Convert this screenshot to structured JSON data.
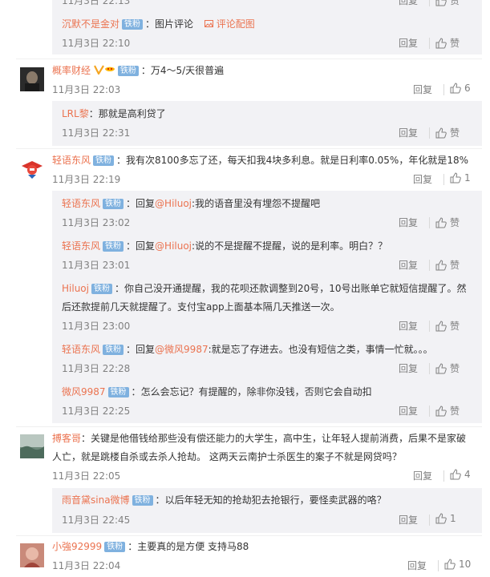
{
  "labels": {
    "reply": "回复",
    "like": "赞",
    "fan_badge": "铁粉"
  },
  "top_partial": {
    "reply": "回复",
    "like": "赞"
  },
  "r0": {
    "name": "沉默不是金对",
    "badge": "铁粉",
    "text": "图片评论",
    "pic_link": "评论配图",
    "time": "11月3日 22:10"
  },
  "c1": {
    "name": "概率财经",
    "badge": "铁粉",
    "text": "万4～5/天很普遍",
    "time": "11月3日 22:03",
    "likes": "6"
  },
  "r1": {
    "name": "LRL黎",
    "text": "那就是高利贷了",
    "time": "11月3日 22:31"
  },
  "c2": {
    "name": "轻语东风",
    "badge": "铁粉",
    "text": "我有次8100多忘了还，每天扣我4块多利息。就是日利率0.05%，年化就是18%",
    "time": "11月3日 22:19",
    "likes": "1"
  },
  "r2a": {
    "name": "轻语东风",
    "badge": "铁粉",
    "prefix": "回复",
    "mention": "@Hiluoj",
    "text": ":我的语音里没有埋怨不提醒吧",
    "time": "11月3日 23:02"
  },
  "r2b": {
    "name": "轻语东风",
    "badge": "铁粉",
    "prefix": "回复",
    "mention": "@Hiluoj",
    "text": ":说的不是提醒不提醒，说的是利率。明白？？",
    "time": "11月3日 23:01"
  },
  "r2c": {
    "name": "Hiluoj",
    "badge": "铁粉",
    "text_line1": "你自己没开通提醒，我的花呗还款调整到20号，10号出账单它就短信提醒了。然",
    "text_line2": "后还款提前几天就提醒了。支付宝app上面基本隔几天推送一次。",
    "time": "11月3日 23:00"
  },
  "r2d": {
    "name": "轻语东风",
    "badge": "铁粉",
    "prefix": "回复",
    "mention": "@微风9987",
    "text": ":就是忘了存进去。也没有短信之类，事情一忙就。。。",
    "time": "11月3日 22:28"
  },
  "r2e": {
    "name": "微风9987",
    "badge": "铁粉",
    "text": "怎么会忘记？有提醒的，除非你没钱，否则它会自动扣",
    "time": "11月3日 22:25"
  },
  "c3": {
    "name": "搏客哥",
    "text_line1": "关键是他借钱给那些没有偿还能力的大学生，高中生，让年轻人提前消费，后果不是家破",
    "text_line2": "人亡，就是跳楼自杀或去杀人抢劫。 这两天云南护士杀医生的案子不就是网贷吗？",
    "time": "11月3日 22:05",
    "likes": "4"
  },
  "r3": {
    "name": "雨音黛sina微博",
    "badge": "铁粉",
    "text": "以后年轻无知的抢劫犯去抢银行，要怪卖武器的咯？",
    "time": "11月3日 22:45",
    "likes": "1"
  },
  "c4": {
    "name": "小強92999",
    "badge": "铁粉",
    "text": "主要真的是方便 支持马88",
    "time": "11月3日 22:04",
    "likes": "10"
  }
}
